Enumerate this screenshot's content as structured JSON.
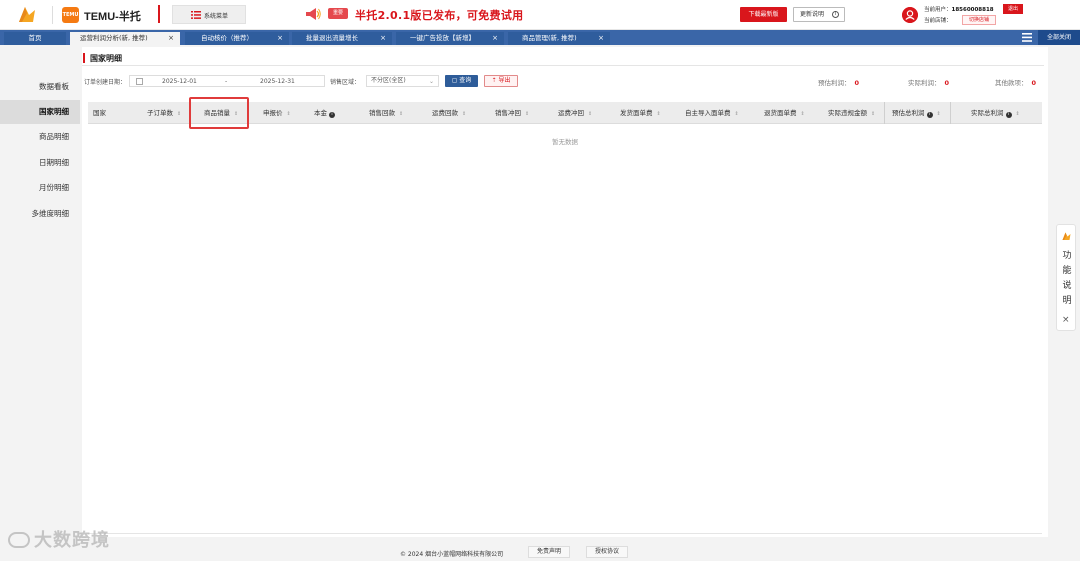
{
  "header": {
    "brand_badge": "TEMU",
    "brand_title": "TEMU-半托",
    "sys_menu_label": "系统菜单",
    "promo_tag": "重要",
    "promo_text": "半托2.0.1版已发布，可免费试用",
    "download_label": "下载最新版",
    "update_label": "更新说明",
    "user_label": "当前用户：",
    "user_value": "18560008818",
    "store_label": "当前店铺：",
    "logout_label": "退出",
    "switch_store_label": "切换店铺"
  },
  "tabs": [
    {
      "label": "首页"
    },
    {
      "label": "运营利润分析(新, 推荐)",
      "close": "×"
    },
    {
      "label": "自动核价（推荐）",
      "close": "×"
    },
    {
      "label": "批量退出流量增长",
      "close": "×"
    },
    {
      "label": "一键广告投放【新增】",
      "close": "×"
    },
    {
      "label": "商品管理(新, 推荐)",
      "close": "×"
    }
  ],
  "close_all_label": "全部关闭",
  "sidebar": {
    "items": [
      {
        "label": "数据看板"
      },
      {
        "label": "国家明细"
      },
      {
        "label": "商品明细"
      },
      {
        "label": "日期明细"
      },
      {
        "label": "月份明细"
      },
      {
        "label": "多维度明细"
      }
    ]
  },
  "panel": {
    "title": "国家明细",
    "filter": {
      "date_label": "订单创建日期：",
      "date_start": "2025-12-01",
      "date_sep": "-",
      "date_end": "2025-12-31",
      "region_label": "销售区域：",
      "region_value": "不分区(全区)",
      "query_label": "查询",
      "export_label": "导出"
    },
    "stats": {
      "est_profit_label": "预估利润：",
      "est_profit_value": "0",
      "actual_profit_label": "实际利润：",
      "actual_profit_value": "0",
      "other_label": "其他款项：",
      "other_value": "0"
    },
    "columns": [
      "国家",
      "子订单数",
      "商品销量",
      "申报价",
      "本金",
      "销售回款",
      "运费回款",
      "销售冲回",
      "运费冲回",
      "发货面单费",
      "自主导入面单费",
      "退货面单费",
      "实际违规金额",
      "预估总利润",
      "实际总利润"
    ],
    "empty_text": "暂无数据"
  },
  "help": {
    "text": "功能说明",
    "close": "×"
  },
  "footer": {
    "copyright": "© 2024 烟台小蓝帽网络科技有限公司",
    "disclaimer_label": "免责声明",
    "license_label": "授权协议"
  },
  "watermark": "大数跨境",
  "colors": {
    "accent_red": "#d9161c",
    "tab_blue": "#3a66a8",
    "query_blue": "#2e5c99",
    "brand_orange": "#f57a12"
  }
}
